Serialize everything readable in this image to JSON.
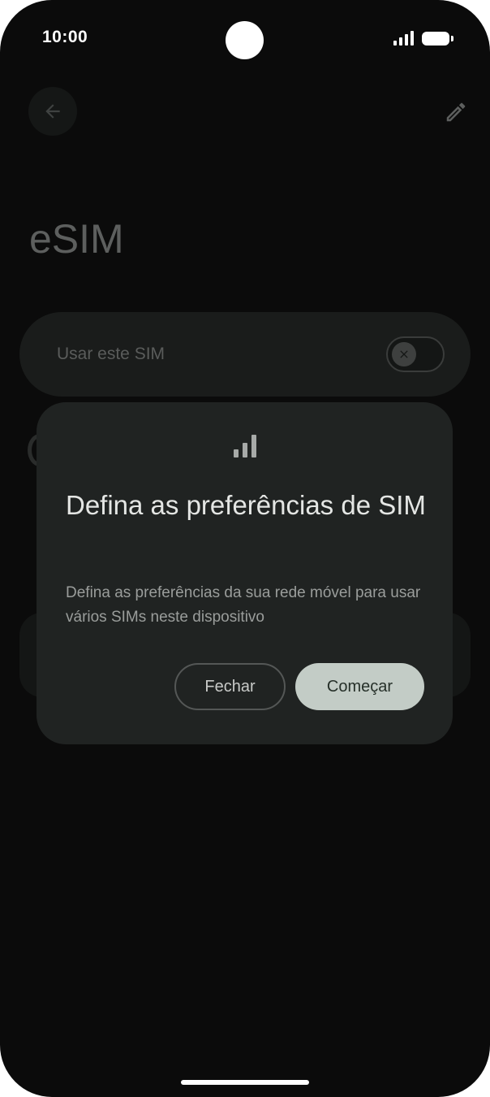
{
  "status_bar": {
    "time": "10:00",
    "icons": [
      "signal-icon",
      "battery-icon"
    ]
  },
  "app_bar": {
    "back_icon": "arrow-left-icon",
    "edit_icon": "pencil-icon"
  },
  "page": {
    "title": "eSIM",
    "sim_toggle": {
      "label": "Usar este SIM",
      "state": "off"
    }
  },
  "dialog": {
    "icon": "signal-bars-icon",
    "title": "Defina as preferências de SIM",
    "body": "Defina as preferências da sua rede móvel para usar vários SIMs neste dispositivo",
    "close_label": "Fechar",
    "start_label": "Começar"
  },
  "colors": {
    "background": "#0b0b0b",
    "dialog_surface": "#202322",
    "primary_button": "#c3ccc6",
    "primary_button_text": "#263029"
  }
}
